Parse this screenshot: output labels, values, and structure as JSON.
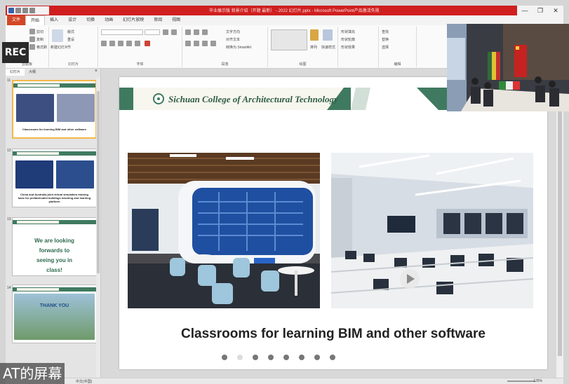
{
  "window": {
    "doc_title": "毕业展示版 背景介绍（开题 最新） - 2022 幻灯片.pptx - Microsoft PowerPoint产品激活失败",
    "min": "—",
    "max": "❐",
    "close": "✕"
  },
  "ribbon_tabs": [
    "文件",
    "开始",
    "插入",
    "设计",
    "切换",
    "动画",
    "幻灯片放映",
    "审阅",
    "视图"
  ],
  "ribbon": {
    "paste": "粘贴",
    "cut": "剪切",
    "copy": "复制",
    "format_painter": "格式刷",
    "new_slide": "新建幻灯片",
    "layout": "版式",
    "reset": "重设",
    "section": "节",
    "clipboard_label": "剪贴板",
    "slides_label": "幻灯片",
    "font_label": "字体",
    "paragraph_label": "段落",
    "drawing_label": "绘图",
    "editing_label": "编辑",
    "text_direction": "文字方向",
    "align_text": "对齐文本",
    "smartart": "转换为 SmartArt",
    "arrange": "排列",
    "quick_styles": "快速样式",
    "shape_fill": "形状填充",
    "shape_outline": "形状轮廓",
    "shape_effects": "形状效果",
    "find": "查找",
    "replace": "替换",
    "select": "选择"
  },
  "rec_label": "REC",
  "panel": {
    "tab_slides": "幻灯片",
    "tab_outline": "大纲",
    "close": "×"
  },
  "thumbnails": [
    {
      "num": "11",
      "text": "Classrooms for learning BIM and other software"
    },
    {
      "num": "12",
      "text": "China and Australia joint virtual simulation training base for prefabricated buildings teaching and learning platform"
    },
    {
      "num": "13",
      "text": "We are looking forwards to seeing you in class!"
    },
    {
      "num": "14",
      "text": "THANK YOU"
    }
  ],
  "slide": {
    "college_name": "Sichuan College of Architectural Technology",
    "caption": "Classrooms for learning BIM and other software",
    "dot_count": 8
  },
  "statusbar": {
    "left": "中文(中国)",
    "zoom": "125%"
  },
  "overlay_text": "AT的屏幕",
  "colors": {
    "accent_green": "#3f7a60",
    "titlebar_red": "#cf1f1f",
    "file_tab": "#d24726"
  }
}
